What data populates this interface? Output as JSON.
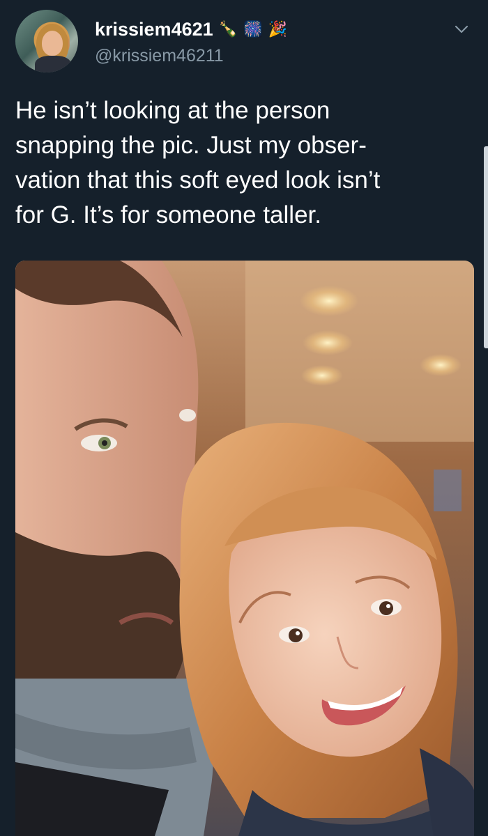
{
  "tweet": {
    "display_name": "krissiem4621",
    "name_emojis": [
      "🍾",
      "🎆",
      "🎉"
    ],
    "handle": "@krissiem46211",
    "text": "He isn’t looking at the person\nsnapping the pic. Just my obser-\nvation that this soft eyed look isn’t\nfor G. It’s for someone taller.",
    "menu_icon": "chevron-down-icon"
  },
  "colors": {
    "background": "#15202b",
    "text_primary": "#ffffff",
    "text_secondary": "#8899a6"
  }
}
